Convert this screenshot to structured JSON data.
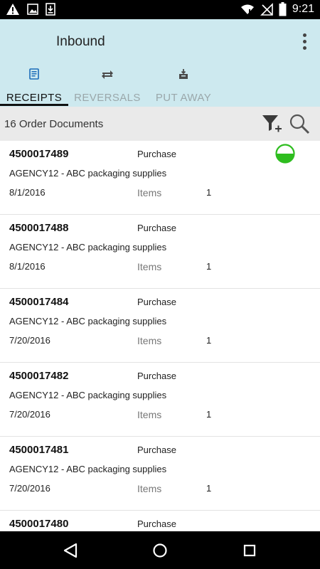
{
  "status_bar": {
    "time": "9:21",
    "left_icons": [
      "warning-icon",
      "image-icon",
      "download-icon"
    ],
    "right_icons": [
      "wifi-icon",
      "no-signal-icon",
      "battery-icon"
    ]
  },
  "header": {
    "title": "Inbound",
    "menu_icon": "more-vertical-icon"
  },
  "tabs": [
    {
      "label": "RECEIPTS",
      "icon": "receipt-icon",
      "active": true
    },
    {
      "label": "REVERSALS",
      "icon": "reverse-icon",
      "active": false
    },
    {
      "label": "PUT AWAY",
      "icon": "put-away-icon",
      "active": false
    }
  ],
  "toolbar": {
    "count_label": "16 Order Documents",
    "filter_icon": "filter-add-icon",
    "search_icon": "search-icon"
  },
  "orders": [
    {
      "number": "4500017489",
      "type": "Purchase",
      "vendor": "AGENCY12 - ABC packaging supplies",
      "date": "8/1/2016",
      "items_label": "Items",
      "items": "1",
      "status": "partially-received",
      "status_color": "#2ebd1f"
    },
    {
      "number": "4500017488",
      "type": "Purchase",
      "vendor": "AGENCY12 - ABC packaging supplies",
      "date": "8/1/2016",
      "items_label": "Items",
      "items": "1"
    },
    {
      "number": "4500017484",
      "type": "Purchase",
      "vendor": "AGENCY12 - ABC packaging supplies",
      "date": "7/20/2016",
      "items_label": "Items",
      "items": "1"
    },
    {
      "number": "4500017482",
      "type": "Purchase",
      "vendor": "AGENCY12 - ABC packaging supplies",
      "date": "7/20/2016",
      "items_label": "Items",
      "items": "1"
    },
    {
      "number": "4500017481",
      "type": "Purchase",
      "vendor": "AGENCY12 - ABC packaging supplies",
      "date": "7/20/2016",
      "items_label": "Items",
      "items": "1"
    },
    {
      "number": "4500017480",
      "type": "Purchase",
      "vendor": "",
      "date": "",
      "items_label": "",
      "items": ""
    }
  ],
  "nav_bar": {
    "back_icon": "back-triangle-icon",
    "home_icon": "home-circle-icon",
    "recents_icon": "recents-square-icon"
  },
  "colors": {
    "header_bg": "#cde9ef",
    "toolbar_bg": "#eaeaea",
    "accent_green": "#2ebd1f"
  }
}
